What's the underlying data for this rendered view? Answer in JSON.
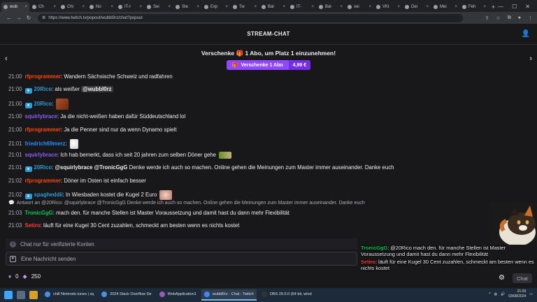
{
  "browser": {
    "tabs": [
      {
        "label": "wub",
        "active": true
      },
      {
        "label": "Ch"
      },
      {
        "label": "Chi"
      },
      {
        "label": "No"
      },
      {
        "label": "IT-I"
      },
      {
        "label": "Sei"
      },
      {
        "label": "Ste"
      },
      {
        "label": "Exp"
      },
      {
        "label": "Tw"
      },
      {
        "label": "Bal"
      },
      {
        "label": "IT-"
      },
      {
        "label": "Bal"
      },
      {
        "label": "sei"
      },
      {
        "label": "VKI"
      },
      {
        "label": "Dei"
      },
      {
        "label": "Mei"
      },
      {
        "label": "Feh"
      }
    ],
    "new_tab": "+",
    "url": "https://www.twitch.tv/popout/wubbl0rz/chat?popout"
  },
  "chat": {
    "header_title": "STREAM-CHAT",
    "promo_prefix": "Verschenke ",
    "promo_count": "1",
    "promo_suffix": " Abo, um Platz 1 einzunehmen!",
    "gift_button_label": "Verschenke 1 Abo",
    "gift_button_price": "4,99 €",
    "messages": [
      {
        "time": "21:00",
        "user": "rfprogrammer",
        "color": "#ff4500",
        "text": ": Wandern Sächsische Schweiz und radfahren"
      },
      {
        "time": "21:00",
        "user": "20Rico",
        "color": "#2b9bd9",
        "badge": true,
        "text": ": als weißer ",
        "mention": "@wubbl0rz"
      },
      {
        "time": "21:00",
        "user": "20Rico",
        "color": "#2b9bd9",
        "badge": true,
        "text": ":",
        "emote": "rock"
      },
      {
        "time": "21:00",
        "user": "squirlybrace",
        "color": "#8a5cf6",
        "text": ": Ja die nicht-weißen haben dafür Süddeutschland lol"
      },
      {
        "time": "21:00",
        "user": "rfprogrammer",
        "color": "#ff4500",
        "text": ": Ja die Penner sind nur da wenn Dynamo spielt"
      },
      {
        "time": "21:01",
        "user": "friedrich69merz",
        "color": "#1e90ff",
        "text": ":",
        "emote": "ghost"
      },
      {
        "time": "21:01",
        "user": "squirlybrace",
        "color": "#8a5cf6",
        "text": ": Ich hab bemerkt, dass ich seit 20 jahren zum selben Döner gehe",
        "emote": "doner"
      },
      {
        "time": "21:01",
        "user": "20Rico",
        "color": "#2b9bd9",
        "badge": true,
        "text": ": ",
        "mention_bold": "@squirlybrace @TronicGgG",
        "text2": " Denke werde ich auch so machen. Online gehen die Meinungen zum Master immer auseinander. Danke euch"
      },
      {
        "time": "21:02",
        "user": "rfprogrammer",
        "color": "#ff4500",
        "text": ": Döner im Osten ist einfach besser"
      },
      {
        "time": "21:02",
        "user": "spagheddii",
        "color": "#2b9bd9",
        "badge": true,
        "text": ": In Wiesbaden kostet die Kugel 2 Euro",
        "emote": "face"
      },
      {
        "time": "21:03",
        "user": "TronicGgG",
        "color": "#00c853",
        "text": ": mach den. für manche Stellen ist Master Voraussetzung und damit hast du dann mehr Flexibilität"
      },
      {
        "time": "21:03",
        "user": "Setiro",
        "color": "#ff3b30",
        "text": ": läuft für eine Kugel 30 Cent zuzahlen, schmeckt am besten wenn es nichts kostet"
      }
    ],
    "reply_text": "Antwort an @20Rico: @squirlybrace @TronicGgG Denke werde ich auch so machen. Online gehen die Meinungen zum Master immer auseinander. Danke euch",
    "verify_notice": "Chat nur für verifizierte Konten",
    "input_placeholder": "Eine Nachricht senden",
    "points": "0",
    "bits": "250",
    "chat_button": "Chat"
  },
  "overlay": {
    "messages": [
      {
        "user": "TronicGgG",
        "color": "#00c853",
        "text": ": @20Rico mach den. für manche Stellen ist Master Voraussetzung und damit hast du dann mehr Flexibilität"
      },
      {
        "user": "Setiro",
        "color": "#ff3b30",
        "text": ": läuft für eine Kugel 30 Cent zuzahlen, schmeckt am besten wenn es nichts kostet"
      }
    ]
  },
  "taskbar": {
    "apps": [
      {
        "label": "chill Nintendo tunes | sq",
        "color": "#4a90e2"
      },
      {
        "label": "2024 Stack Overflow De",
        "color": "#4a90e2"
      },
      {
        "label": "WebApplication1",
        "color": "#9b59b6"
      },
      {
        "label": "wubbl0rz - Chat - Twitch",
        "color": "#4285f4",
        "active": true
      },
      {
        "label": "OBS 29.0.0 (64-bit, wind",
        "color": "#333333"
      }
    ],
    "time": "21:03",
    "date": "03/08/2024"
  }
}
